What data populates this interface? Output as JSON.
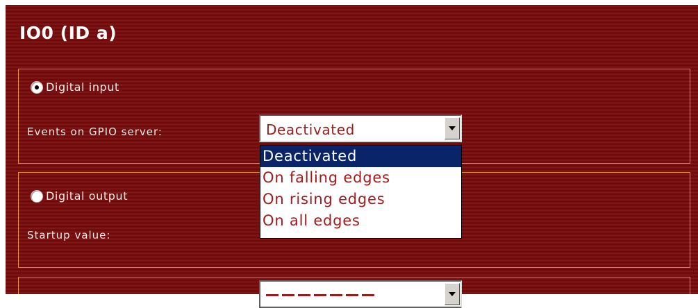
{
  "page": {
    "title": "IO0 (ID a)"
  },
  "sections": [
    {
      "radio_label": "Digital input",
      "radio_checked": true,
      "field_label": "Events on GPIO server:",
      "select": {
        "value": "Deactivated",
        "expanded": true,
        "options": [
          "Deactivated",
          "On falling edges",
          "On rising edges",
          "On all edges"
        ],
        "selected_index": 0
      }
    },
    {
      "radio_label": "Digital output",
      "radio_checked": false,
      "field_label": "Startup value:"
    }
  ],
  "colors": {
    "panel_background": "#7e0c0c",
    "section_border": "#e7932b",
    "option_text": "#a31a1a",
    "selected_option_background": "#0a246a"
  },
  "icons": {
    "dropdown": "chevron-down-icon"
  }
}
